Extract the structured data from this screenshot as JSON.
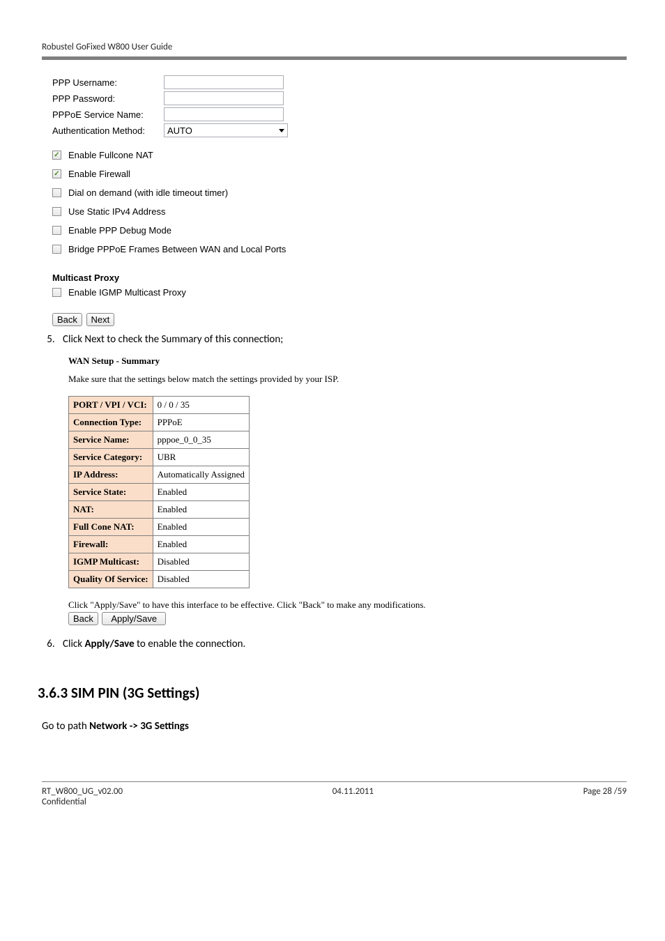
{
  "header": {
    "title": "Robustel GoFixed W800 User Guide"
  },
  "form": {
    "ppp_username_label": "PPP Username:",
    "ppp_username_value": "",
    "ppp_password_label": "PPP Password:",
    "ppp_password_value": "",
    "pppoe_service_label": "PPPoE Service Name:",
    "pppoe_service_value": "",
    "auth_method_label": "Authentication Method:",
    "auth_method_value": "AUTO"
  },
  "checks": [
    {
      "label": "Enable Fullcone NAT",
      "checked": true
    },
    {
      "label": "Enable Firewall",
      "checked": true
    },
    {
      "label": "Dial on demand (with idle timeout timer)",
      "checked": false
    },
    {
      "label": "Use Static IPv4 Address",
      "checked": false
    },
    {
      "label": "Enable PPP Debug Mode",
      "checked": false
    },
    {
      "label": "Bridge PPPoE Frames Between WAN and Local Ports",
      "checked": false
    }
  ],
  "multicast": {
    "heading": "Multicast Proxy",
    "label": "Enable IGMP Multicast Proxy",
    "checked": false
  },
  "nav1": {
    "back": "Back",
    "next": "Next"
  },
  "steps": {
    "five": "Click Next to check the Summary of this connection;",
    "six_pre": "Click ",
    "six_b": "Apply/Save",
    "six_post": " to enable the connection."
  },
  "wan": {
    "heading": "WAN Setup - Summary",
    "note": "Make sure that the settings below match the settings provided by your ISP.",
    "rows": [
      {
        "k": "PORT / VPI / VCI:",
        "v": "0 / 0 / 35"
      },
      {
        "k": "Connection Type:",
        "v": "PPPoE"
      },
      {
        "k": "Service Name:",
        "v": "pppoe_0_0_35"
      },
      {
        "k": "Service Category:",
        "v": "UBR"
      },
      {
        "k": "IP Address:",
        "v": "Automatically Assigned"
      },
      {
        "k": "Service State:",
        "v": "Enabled"
      },
      {
        "k": "NAT:",
        "v": "Enabled"
      },
      {
        "k": "Full Cone NAT:",
        "v": "Enabled"
      },
      {
        "k": "Firewall:",
        "v": "Enabled"
      },
      {
        "k": "IGMP Multicast:",
        "v": "Disabled"
      },
      {
        "k": "Quality Of Service:",
        "v": "Disabled"
      }
    ],
    "post": "Click \"Apply/Save\" to have this interface to be effective. Click \"Back\" to make any modifications.",
    "back": "Back",
    "apply": "Apply/Save"
  },
  "section": {
    "title": "3.6.3 SIM PIN (3G Settings)"
  },
  "body": {
    "goto_pre": "Go to path ",
    "goto_b": "Network -> 3G Settings"
  },
  "footer": {
    "left": "RT_W800_UG_v02.00",
    "conf": "Confidential",
    "mid": "04.11.2011",
    "right": "Page 28 /59"
  }
}
